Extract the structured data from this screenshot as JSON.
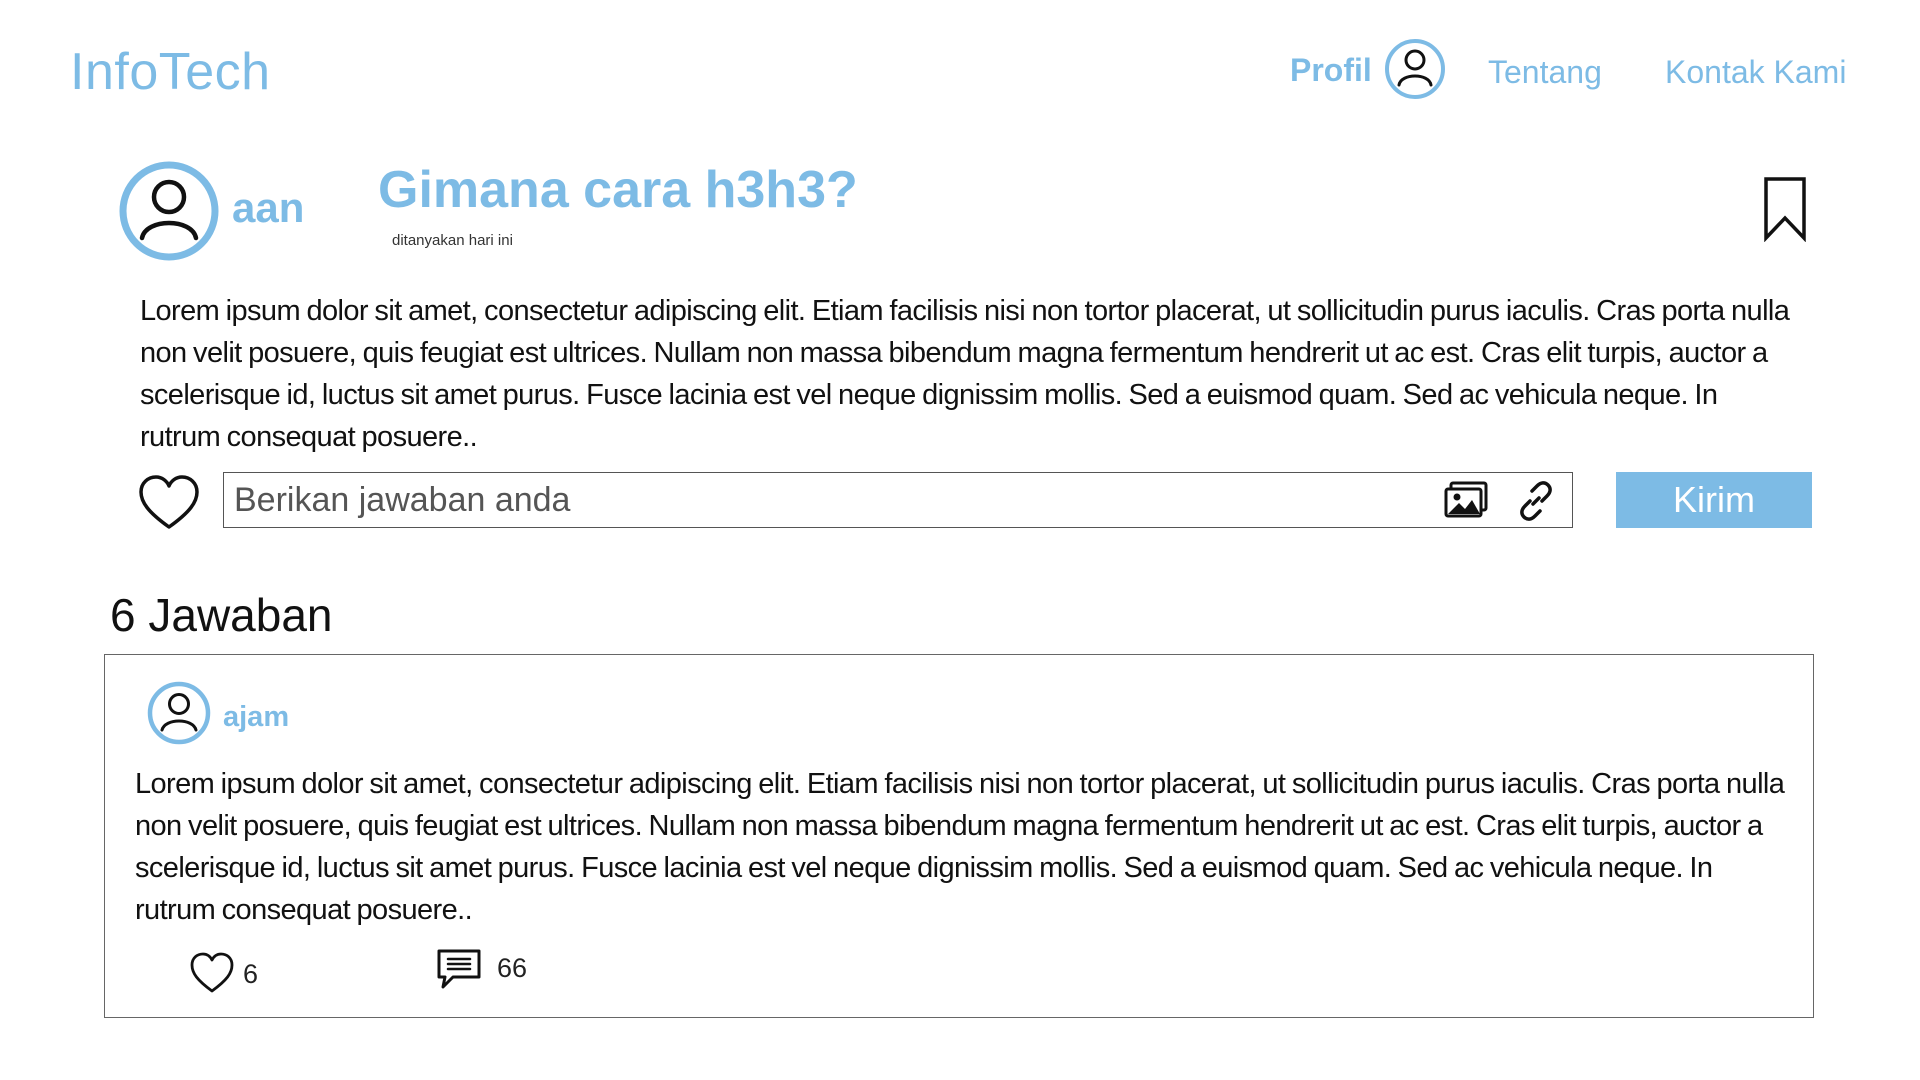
{
  "header": {
    "brand": "InfoTech",
    "nav": {
      "profil": "Profil",
      "tentang": "Tentang",
      "kontak": "Kontak Kami"
    }
  },
  "question": {
    "author": "aan",
    "title": "Gimana cara h3h3?",
    "meta": "ditanyakan hari ini",
    "body": "Lorem ipsum dolor sit amet, consectetur adipiscing elit. Etiam facilisis nisi non tortor placerat, ut sollicitudin purus iaculis. Cras porta nulla non velit posuere, quis feugiat est ultrices. Nullam non massa bibendum magna fermentum hendrerit ut ac est. Cras elit turpis, auctor a scelerisque id, luctus sit amet purus. Fusce lacinia est vel neque dignissim mollis. Sed a euismod quam. Sed ac vehicula neque. In rutrum consequat posuere.."
  },
  "answer_form": {
    "placeholder": "Berikan jawaban anda",
    "value": "",
    "submit_label": "Kirim"
  },
  "answers": {
    "count_label": "6 Jawaban",
    "items": [
      {
        "author": "ajam",
        "body": "Lorem ipsum dolor sit amet, consectetur adipiscing elit. Etiam facilisis nisi non tortor placerat, ut sollicitudin purus iaculis. Cras porta nulla non velit posuere, quis feugiat est ultrices. Nullam non massa bibendum magna fermentum hendrerit ut ac est. Cras elit turpis, auctor a scelerisque id, luctus sit amet purus. Fusce lacinia est vel neque dignissim mollis. Sed a euismod quam. Sed ac vehicula neque. In rutrum consequat posuere..",
        "likes": "6",
        "comments": "66"
      }
    ]
  },
  "icons": {
    "avatar": "user-avatar-icon",
    "bookmark": "bookmark-icon",
    "like": "heart-icon",
    "image": "image-icon",
    "link": "link-icon",
    "comment": "comment-icon"
  },
  "colors": {
    "accent": "#7dbbe5",
    "text": "#111111",
    "border": "#666666"
  }
}
